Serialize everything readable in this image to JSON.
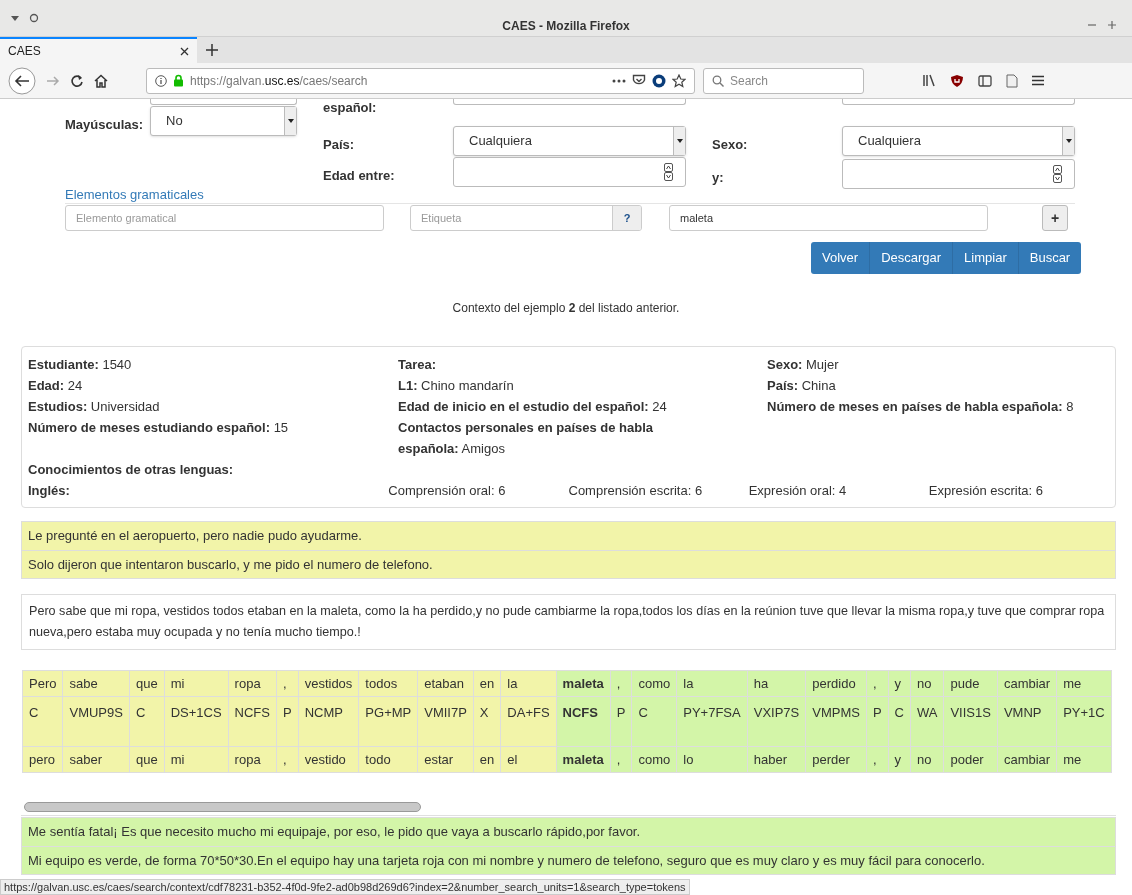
{
  "window": {
    "title": "CAES - Mozilla Firefox"
  },
  "tabs": [
    {
      "label": "CAES",
      "selected": true
    }
  ],
  "address_bar": {
    "url_prefix": "https://galvan.",
    "url_domain": "usc.es",
    "url_path": "/caes/search"
  },
  "search": {
    "placeholder": "Search"
  },
  "form": {
    "cut_label": "español:",
    "fields": [
      {
        "kind": "select",
        "label": "Mayúsculas:",
        "value": "No"
      },
      {
        "kind": "select",
        "label": "País:",
        "value": "Cualquiera"
      },
      {
        "kind": "select",
        "label": "Sexo:",
        "value": "Cualquiera"
      },
      {
        "kind": "number",
        "label": "Edad entre:"
      },
      {
        "kind": "number",
        "label": "y:"
      }
    ],
    "section_title": "Elementos gramaticales",
    "element_placeholder": "Elemento gramatical",
    "tag_placeholder": "Etiqueta",
    "help_button": "?",
    "word_value": "maleta",
    "add_button": "+",
    "buttons": [
      "Volver",
      "Descargar",
      "Limpiar",
      "Buscar"
    ]
  },
  "caption": "Contexto del ejemplo **2** del listado anterior.",
  "student": {
    "columns": [
      [
        "**Estudiante:** 1540",
        "**Edad:** 24",
        "**Estudios:** Universidad",
        "**Número de meses estudiando español:** 15"
      ],
      [
        "**Tarea:**",
        "**L1:** Chino mandarín",
        "**Edad de inicio en el estudio del español:** 24",
        "**Contactos personales en países de habla española:** Amigos"
      ],
      [
        "**Sexo:** Mujer",
        "**País:** China",
        "**Número de meses en países de habla española:** 8"
      ]
    ],
    "languages_title": "Conocimientos de otras lenguas:",
    "language": "Inglés:",
    "scores": [
      "Comprensión oral: 6",
      "Comprensión escrita: 6",
      "Expresión oral: 4",
      "Expresión escrita: 6"
    ]
  },
  "preceding_sentences": [
    "Le pregunté en el aeropuerto, pero nadie pudo ayudarme.",
    "Solo dijeron que intentaron buscarlo, y me pido el numero de telefono."
  ],
  "context_sentence": "Pero sabe que mi ropa, vestidos todos etaban en la maleta, como la ha perdido,y no pude cambiarme la ropa,todos los días en la reúnion tuve que llevar la misma ropa,y tuve que comprar ropa nueva,pero estaba muy ocupada y no tenía mucho tiempo.!",
  "tokens": [
    {
      "word": "Pero",
      "tag": "C",
      "lemma": "pero",
      "kind": "before",
      "match": false
    },
    {
      "word": "sabe",
      "tag": "VMUP9S",
      "lemma": "saber",
      "kind": "before",
      "match": false
    },
    {
      "word": "que",
      "tag": "C",
      "lemma": "que",
      "kind": "before",
      "match": false
    },
    {
      "word": "mi",
      "tag": "DS+1CS",
      "lemma": "mi",
      "kind": "before",
      "match": false
    },
    {
      "word": "ropa",
      "tag": "NCFS",
      "lemma": "ropa",
      "kind": "before",
      "match": false
    },
    {
      "word": ",",
      "tag": "P",
      "lemma": ",",
      "kind": "before",
      "match": false
    },
    {
      "word": "vestidos",
      "tag": "NCMP",
      "lemma": "vestido",
      "kind": "before",
      "match": false
    },
    {
      "word": "todos",
      "tag": "PG+MP",
      "lemma": "todo",
      "kind": "before",
      "match": false
    },
    {
      "word": "etaban",
      "tag": "VMII7P",
      "lemma": "estar",
      "kind": "before",
      "match": false
    },
    {
      "word": "en",
      "tag": "X",
      "lemma": "en",
      "kind": "before",
      "match": false
    },
    {
      "word": "la",
      "tag": "DA+FS",
      "lemma": "el",
      "kind": "before",
      "match": false
    },
    {
      "word": "maleta",
      "tag": "NCFS",
      "lemma": "maleta",
      "kind": "after",
      "match": true
    },
    {
      "word": ",",
      "tag": "P",
      "lemma": ",",
      "kind": "after",
      "match": false
    },
    {
      "word": "como",
      "tag": "C",
      "lemma": "como",
      "kind": "after",
      "match": false
    },
    {
      "word": "la",
      "tag": "PY+7FSA",
      "lemma": "lo",
      "kind": "after",
      "match": false
    },
    {
      "word": "ha",
      "tag": "VXIP7S",
      "lemma": "haber",
      "kind": "after",
      "match": false
    },
    {
      "word": "perdido",
      "tag": "VMPMS",
      "lemma": "perder",
      "kind": "after",
      "match": false
    },
    {
      "word": ",",
      "tag": "P",
      "lemma": ",",
      "kind": "after",
      "match": false
    },
    {
      "word": "y",
      "tag": "C",
      "lemma": "y",
      "kind": "after",
      "match": false
    },
    {
      "word": "no",
      "tag": "WA",
      "lemma": "no",
      "kind": "after",
      "match": false
    },
    {
      "word": "pude",
      "tag": "VIIS1S",
      "lemma": "poder",
      "kind": "after",
      "match": false
    },
    {
      "word": "cambiar",
      "tag": "VMNP",
      "lemma": "cambiar",
      "kind": "after",
      "match": false
    },
    {
      "word": "me",
      "tag": "PY+1C",
      "lemma": "me",
      "kind": "after",
      "match": false
    }
  ],
  "following_sentences": [
    "Me sentía fatal¡ Es que necesito mucho mi equipaje, por eso, le pido que vaya a buscarlo rápido,por favor.",
    "Mi equipo es verde, de forma 70*50*30.En el equipo hay una tarjeta roja con mi nombre y numero de telefono, seguro que es muy claro y es muy fácil para conocerlo."
  ],
  "status_bar": {
    "url": "https://galvan.usc.es/caes/search/context/cdf78231-b352-4f0d-9fe2-ad0b98d269d6?index=2&number_search_units=1&search_type=tokens"
  }
}
